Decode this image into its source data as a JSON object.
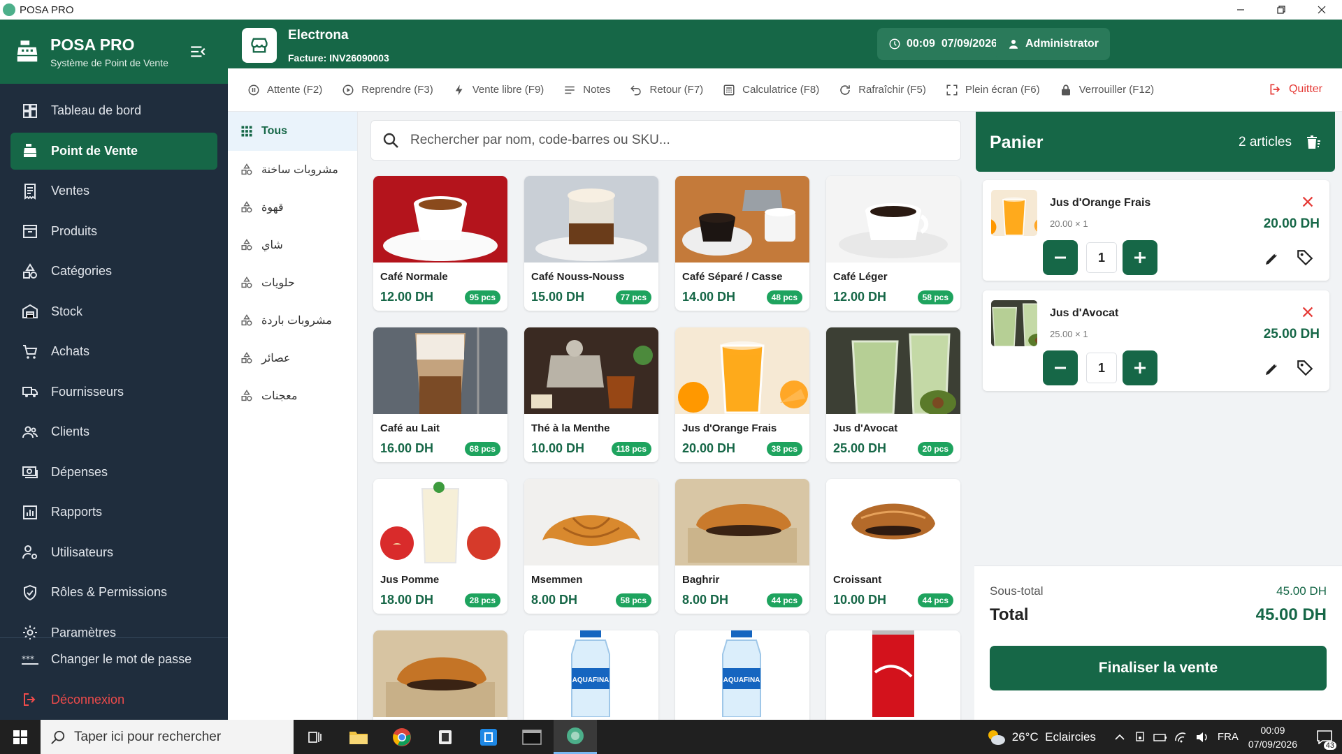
{
  "window": {
    "title": "POSA PRO"
  },
  "brand": {
    "title": "POSA PRO",
    "subtitle": "Système de Point de Vente"
  },
  "nav": {
    "items": [
      {
        "label": "Tableau de bord",
        "icon": "dashboard-icon"
      },
      {
        "label": "Point de Vente",
        "icon": "pos-register-icon",
        "active": true
      },
      {
        "label": "Ventes",
        "icon": "receipt-icon"
      },
      {
        "label": "Produits",
        "icon": "box-icon"
      },
      {
        "label": "Catégories",
        "icon": "shapes-icon"
      },
      {
        "label": "Stock",
        "icon": "warehouse-icon"
      },
      {
        "label": "Achats",
        "icon": "cart-icon"
      },
      {
        "label": "Fournisseurs",
        "icon": "truck-icon"
      },
      {
        "label": "Clients",
        "icon": "users-icon"
      },
      {
        "label": "Dépenses",
        "icon": "cash-icon"
      },
      {
        "label": "Rapports",
        "icon": "chart-icon"
      },
      {
        "label": "Utilisateurs",
        "icon": "user-gear-icon"
      },
      {
        "label": "Rôles & Permissions",
        "icon": "shield-icon"
      },
      {
        "label": "Paramètres",
        "icon": "gear-icon"
      }
    ],
    "change_password": "Changer le mot de passe",
    "logout": "Déconnexion"
  },
  "header": {
    "store_name": "Electrona",
    "invoice": "Facture: INV26090003",
    "clock": "00:09  07/09/2026",
    "user": "Administrator"
  },
  "toolbar": {
    "items": [
      {
        "label": "Attente (F2)",
        "icon": "pause-icon"
      },
      {
        "label": "Reprendre (F3)",
        "icon": "play-icon"
      },
      {
        "label": "Vente libre (F9)",
        "icon": "bolt-icon"
      },
      {
        "label": "Notes",
        "icon": "notes-icon"
      },
      {
        "label": "Retour (F7)",
        "icon": "undo-icon"
      },
      {
        "label": "Calculatrice (F8)",
        "icon": "calculator-icon"
      },
      {
        "label": "Rafraîchir (F5)",
        "icon": "refresh-icon"
      },
      {
        "label": "Plein écran (F6)",
        "icon": "fullscreen-icon"
      },
      {
        "label": "Verrouiller (F12)",
        "icon": "lock-icon"
      }
    ],
    "quit": "Quitter"
  },
  "categories": {
    "all": "Tous",
    "items": [
      "مشروبات ساخنة",
      "قهوة",
      "شاي",
      "حلويات",
      "مشروبات باردة",
      "عصائر",
      "معجنات"
    ]
  },
  "search": {
    "placeholder": "Rechercher par nom, code-barres ou SKU..."
  },
  "products": [
    {
      "name": "Café Normale",
      "price": "12.00 DH",
      "stock": "95 pcs",
      "img": "espresso"
    },
    {
      "name": "Café Nouss-Nouss",
      "price": "15.00 DH",
      "stock": "77 pcs",
      "img": "nousnous"
    },
    {
      "name": "Café Séparé / Casse",
      "price": "14.00 DH",
      "stock": "48 pcs",
      "img": "separe"
    },
    {
      "name": "Café Léger",
      "price": "12.00 DH",
      "stock": "58 pcs",
      "img": "leger"
    },
    {
      "name": "Café au Lait",
      "price": "16.00 DH",
      "stock": "68 pcs",
      "img": "latte"
    },
    {
      "name": "Thé à la Menthe",
      "price": "10.00 DH",
      "stock": "118 pcs",
      "img": "tea"
    },
    {
      "name": "Jus d'Orange Frais",
      "price": "20.00 DH",
      "stock": "38 pcs",
      "img": "orange"
    },
    {
      "name": "Jus d'Avocat",
      "price": "25.00 DH",
      "stock": "20 pcs",
      "img": "avocado"
    },
    {
      "name": "Jus Pomme",
      "price": "18.00 DH",
      "stock": "28 pcs",
      "img": "apple"
    },
    {
      "name": "Msemmen",
      "price": "8.00 DH",
      "stock": "58 pcs",
      "img": "croissant"
    },
    {
      "name": "Baghrir",
      "price": "8.00 DH",
      "stock": "44 pcs",
      "img": "pastry"
    },
    {
      "name": "Croissant",
      "price": "10.00 DH",
      "stock": "44 pcs",
      "img": "painchoc"
    },
    {
      "img": "pastry2"
    },
    {
      "img": "water",
      "brand": "AQUAFINA"
    },
    {
      "img": "water2",
      "brand": "AQUAFINA"
    },
    {
      "img": "cola"
    }
  ],
  "cart": {
    "title": "Panier",
    "count": "2 articles",
    "items": [
      {
        "name": "Jus d'Orange Frais",
        "unit": "20.00 × 1",
        "qty": "1",
        "total": "20.00 DH",
        "img": "orange"
      },
      {
        "name": "Jus d'Avocat",
        "unit": "25.00 × 1",
        "qty": "1",
        "total": "25.00 DH",
        "img": "avocado"
      }
    ],
    "subtotal_label": "Sous-total",
    "subtotal": "45.00 DH",
    "total_label": "Total",
    "total": "45.00 DH",
    "finalize": "Finaliser la vente"
  },
  "taskbar": {
    "search_placeholder": "Taper ici pour rechercher",
    "weather": "26°C  Eclaircies",
    "lang": "FRA",
    "time": "00:09",
    "date": "07/09/2026",
    "notifications": "43"
  },
  "colors": {
    "primary": "#166747",
    "sidebar": "#1f2d3d",
    "stock_badge": "#1ea35e",
    "danger": "#e53935"
  }
}
